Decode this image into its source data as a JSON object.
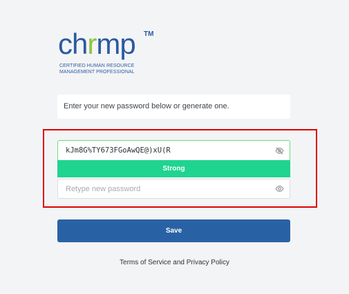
{
  "logo": {
    "word_part1": "ch",
    "word_part2": "r",
    "word_part3": "mp",
    "trademark": "TM",
    "subtitle_line1": "CERTIFIED HUMAN RESOURCE",
    "subtitle_line2": "MANAGEMENT PROFESSIONAL",
    "colors": {
      "blue": "#2b5aa0",
      "green": "#8cc63f"
    }
  },
  "message": "Enter your new password below or generate one.",
  "new_password": {
    "value": "kJm8G%TY673FGoAwQE@)xU(R",
    "toggle_icon": "eye-slash-icon"
  },
  "strength": {
    "label": "Strong",
    "color": "#1fd48e"
  },
  "retype_password": {
    "placeholder": "Retype new password",
    "toggle_icon": "eye-icon"
  },
  "save_button": {
    "label": "Save",
    "color": "#2962a4"
  },
  "footer": {
    "link1": "Terms of Service",
    "joiner": " and ",
    "link2": "Privacy Policy"
  },
  "highlight_color": "#e00000"
}
